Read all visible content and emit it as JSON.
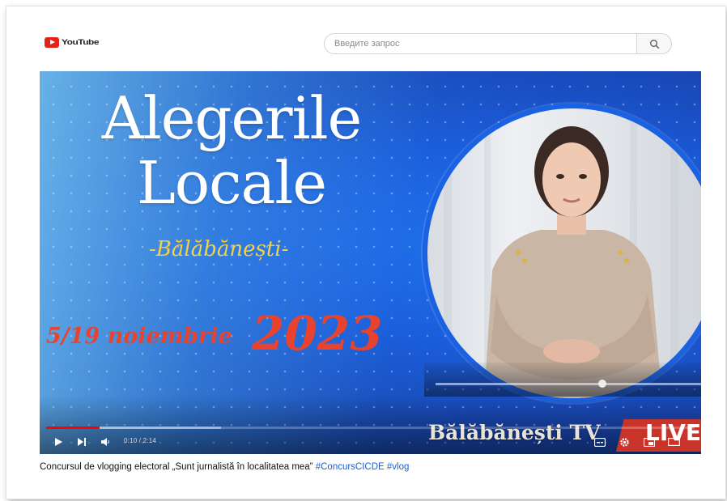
{
  "header": {
    "logo_text": "YouTube",
    "search_placeholder": "Введите запрос"
  },
  "thumbnail": {
    "title_line1": "Alegerile",
    "title_line2": "Locale",
    "place": "-Bălăbănești-",
    "dates": "5/19 noiembrie",
    "year": "2023",
    "channel_brand": "Bălăbănești TV",
    "live_label": "LIVE"
  },
  "player": {
    "time_display": "0:10 / 2:14",
    "progress_fraction": 0.083,
    "buffer_fraction": 0.27,
    "play_state": "paused"
  },
  "caption": {
    "text": "Concursul de vlogging electoral „Sunt jurnalistă în localitatea mea” ",
    "hashtags": "#ConcursCICDE #vlog"
  },
  "colors": {
    "accent_red": "#e8432e",
    "place_yellow": "#f4d046",
    "progress_red": "#ff0000",
    "ring_blue": "#1b62e3"
  },
  "icons": [
    "youtube-logo-icon",
    "search-icon",
    "play-icon",
    "next-icon",
    "volume-icon",
    "subtitles-icon",
    "settings-icon",
    "miniplayer-icon",
    "theater-icon"
  ]
}
